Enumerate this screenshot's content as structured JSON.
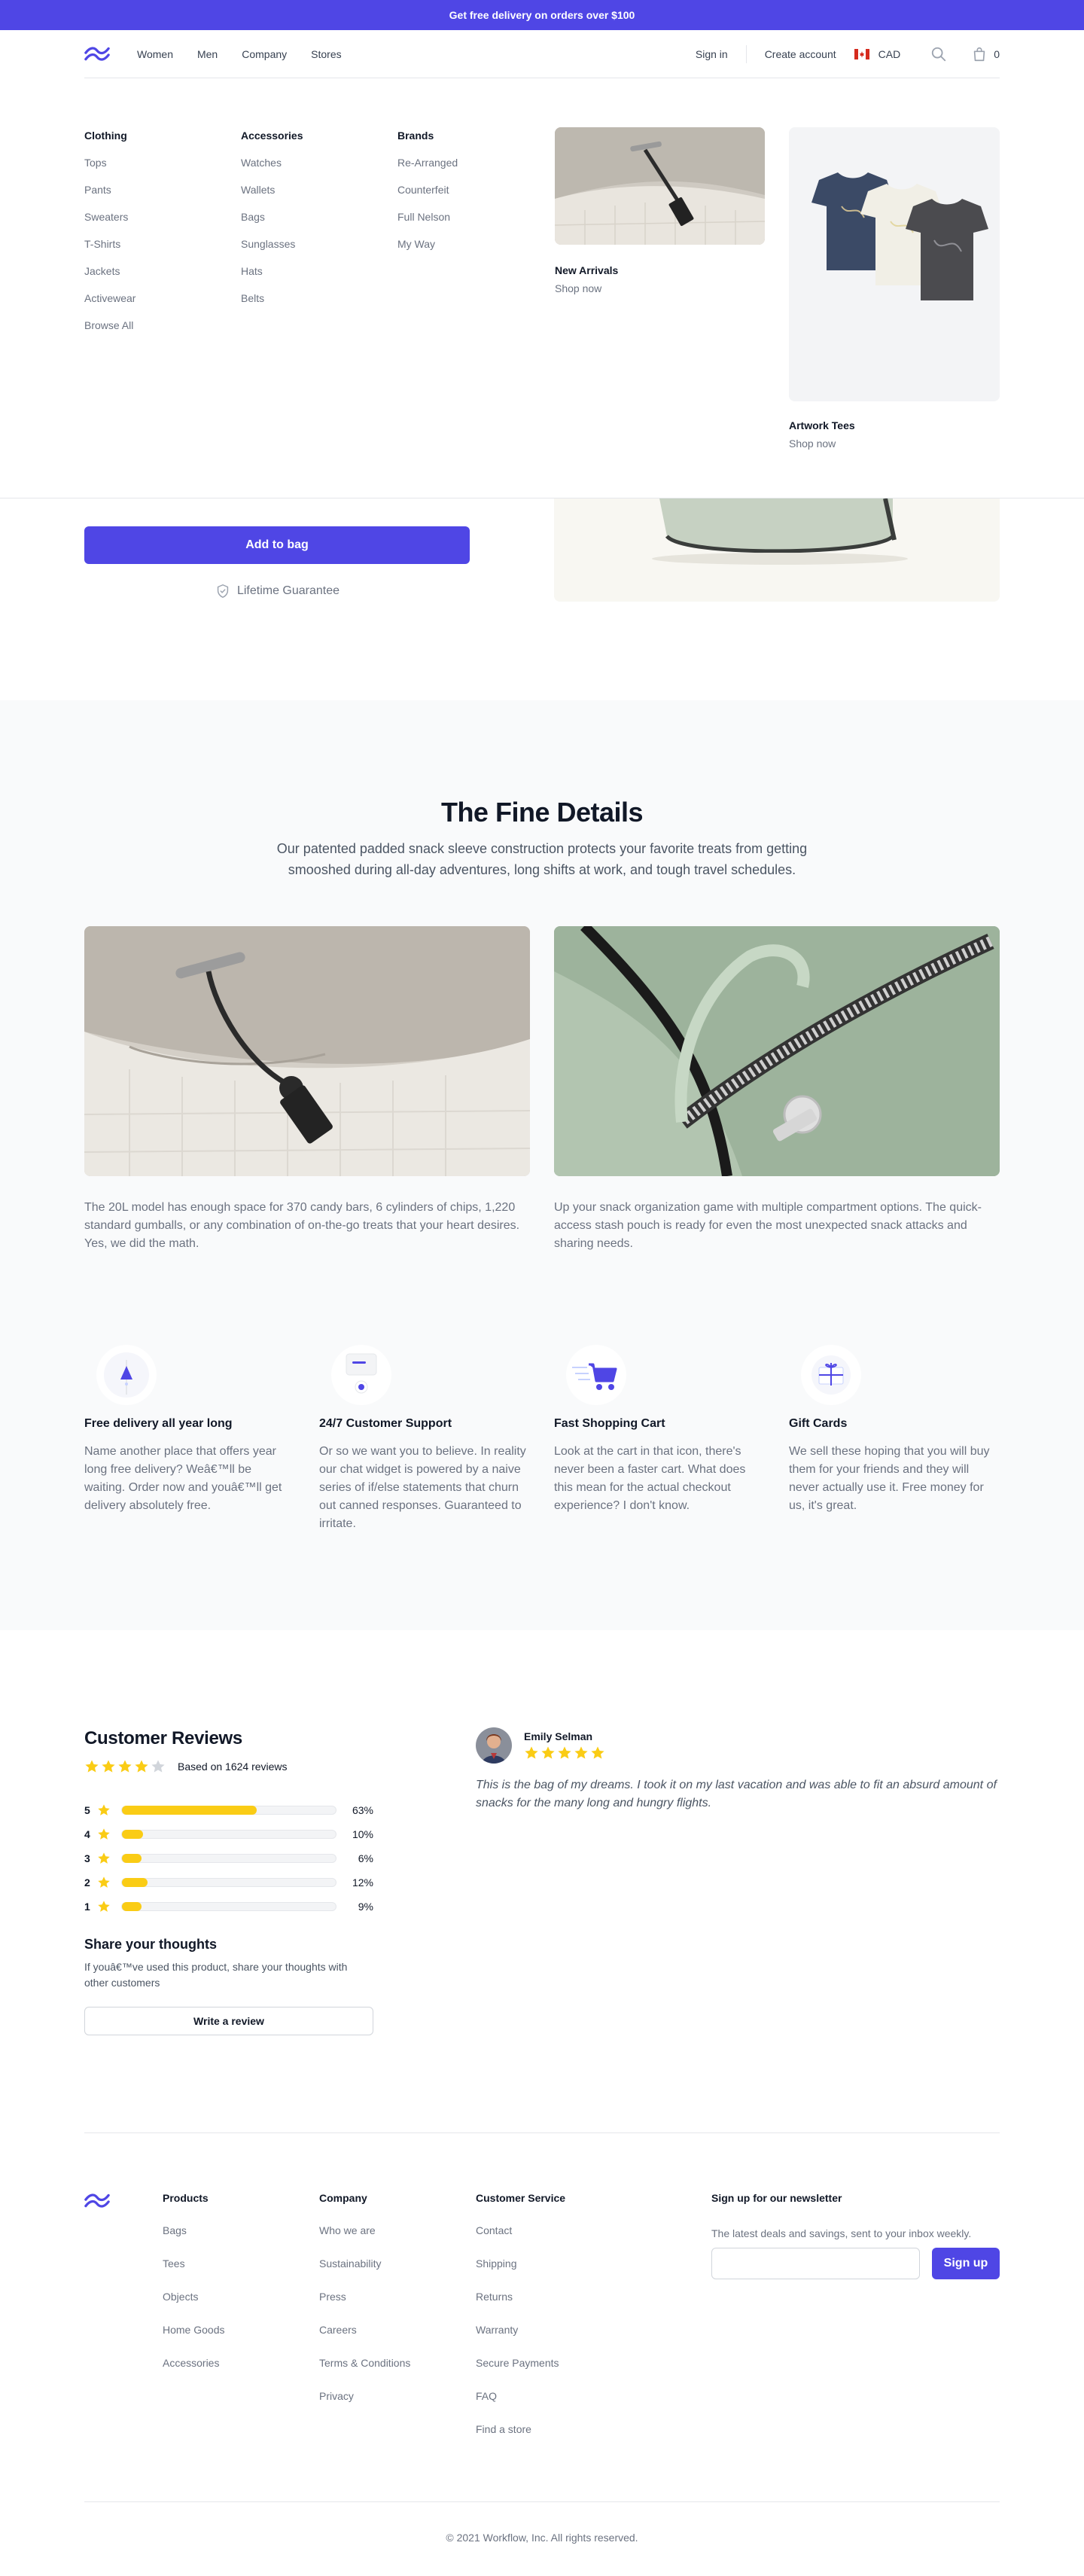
{
  "promo": {
    "text": "Get free delivery on orders over $100"
  },
  "header": {
    "nav": [
      "Women",
      "Men",
      "Company",
      "Stores"
    ],
    "sign_in": "Sign in",
    "create_account": "Create account",
    "currency": "CAD",
    "cart_count": "0",
    "icons": {
      "logo": "workflow-logo",
      "flag": "canada-flag-icon",
      "search": "search-icon",
      "cart": "shopping-bag-icon"
    }
  },
  "mega_menu": {
    "columns": [
      {
        "title": "Clothing",
        "links": [
          "Tops",
          "Pants",
          "Sweaters",
          "T-Shirts",
          "Jackets",
          "Activewear",
          "Browse All"
        ]
      },
      {
        "title": "Accessories",
        "links": [
          "Watches",
          "Wallets",
          "Bags",
          "Sunglasses",
          "Hats",
          "Belts"
        ]
      },
      {
        "title": "Brands",
        "links": [
          "Re-Arranged",
          "Counterfeit",
          "Full Nelson",
          "My Way"
        ]
      }
    ],
    "featured": [
      {
        "title": "New Arrivals",
        "cta": "Shop now"
      },
      {
        "title": "Artwork Tees",
        "cta": "Shop now"
      }
    ]
  },
  "product": {
    "add_to_bag": "Add to bag",
    "guarantee": "Lifetime Guarantee"
  },
  "details": {
    "title": "The Fine Details",
    "lead": "Our patented padded snack sleeve construction protects your favorite treats from getting smooshed during all-day adventures, long shifts at work, and tough travel schedules.",
    "items": [
      {
        "text": "The 20L model has enough space for 370 candy bars, 6 cylinders of chips, 1,220 standard gumballs, or any combination of on-the-go treats that your heart desires. Yes, we did the math."
      },
      {
        "text": "Up your snack organization game with multiple compartment options. The quick-access stash pouch is ready for even the most unexpected snack attacks and sharing needs."
      }
    ],
    "perks": [
      {
        "icon": "delivery-icon",
        "title": "Free delivery all year long",
        "text": "Name another place that offers year long free delivery? Weâ€™ll be waiting. Order now and youâ€™ll get delivery absolutely free."
      },
      {
        "icon": "chat-support-icon",
        "title": "24/7 Customer Support",
        "text": "Or so we want you to believe. In reality our chat widget is powered by a naive series of if/else statements that churn out canned responses. Guaranteed to irritate."
      },
      {
        "icon": "fast-cart-icon",
        "title": "Fast Shopping Cart",
        "text": "Look at the cart in that icon, there's never been a faster cart. What does this mean for the actual checkout experience? I don't know."
      },
      {
        "icon": "gift-card-icon",
        "title": "Gift Cards",
        "text": "We sell these hoping that you will buy them for your friends and they will never actually use it. Free money for us, it's great."
      }
    ]
  },
  "reviews": {
    "title": "Customer Reviews",
    "average_rating": 4,
    "based_on": "Based on 1624 reviews",
    "distribution": [
      {
        "stars": "5",
        "fraction": 0.63,
        "pct": "63%"
      },
      {
        "stars": "4",
        "fraction": 0.1,
        "pct": "10%"
      },
      {
        "stars": "3",
        "fraction": 0.06,
        "pct": "6%"
      },
      {
        "stars": "2",
        "fraction": 0.12,
        "pct": "12%"
      },
      {
        "stars": "1",
        "fraction": 0.09,
        "pct": "9%"
      }
    ],
    "share_title": "Share your thoughts",
    "share_text": "If youâ€™ve used this product, share your thoughts with other customers",
    "write_button": "Write a review",
    "featured_review": {
      "author": "Emily Selman",
      "rating": 5,
      "text": "This is the bag of my dreams. I took it on my last vacation and was able to fit an absurd amount of snacks for the many long and hungry flights."
    },
    "colors": {
      "star": "#facc15",
      "star_empty": "#d1d5db"
    }
  },
  "footer": {
    "columns": [
      {
        "title": "Products",
        "links": [
          "Bags",
          "Tees",
          "Objects",
          "Home Goods",
          "Accessories"
        ]
      },
      {
        "title": "Company",
        "links": [
          "Who we are",
          "Sustainability",
          "Press",
          "Careers",
          "Terms & Conditions",
          "Privacy"
        ]
      },
      {
        "title": "Customer Service",
        "links": [
          "Contact",
          "Shipping",
          "Returns",
          "Warranty",
          "Secure Payments",
          "FAQ",
          "Find a store"
        ]
      }
    ],
    "newsletter": {
      "title": "Sign up for our newsletter",
      "text": "The latest deals and savings, sent to your inbox weekly.",
      "input_value": "",
      "button": "Sign up"
    },
    "copyright": "© 2021 Workflow, Inc. All rights reserved."
  },
  "colors": {
    "accent": "#4f46e5",
    "details_bg": "#f9fafb"
  }
}
